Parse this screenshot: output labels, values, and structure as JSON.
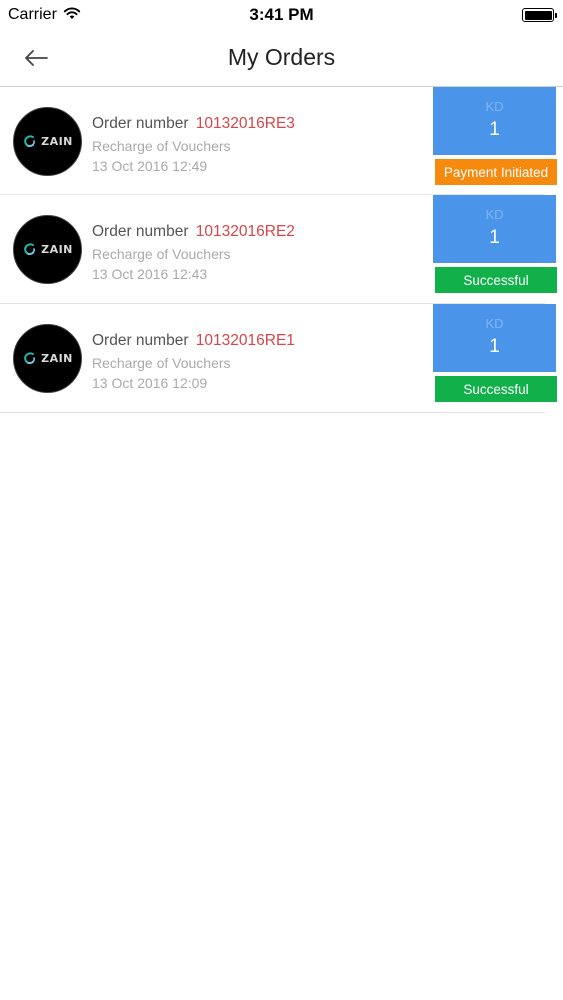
{
  "status_bar": {
    "carrier": "Carrier",
    "time": "3:41 PM",
    "icons": [
      "wifi-icon",
      "battery-icon"
    ]
  },
  "nav": {
    "title": "My Orders",
    "back_icon": "arrow-left-icon"
  },
  "orders": [
    {
      "label": "Order number",
      "number": "10132016RE3",
      "description": "Recharge of Vouchers",
      "date": "13 Oct 2016 12:49",
      "currency": "KD",
      "amount": "1",
      "status": "Payment Initiated",
      "status_color": "#f58a0f",
      "logo_text": "ZAIN"
    },
    {
      "label": "Order number",
      "number": "10132016RE2",
      "description": "Recharge of Vouchers",
      "date": "13 Oct 2016 12:43",
      "currency": "KD",
      "amount": "1",
      "status": "Successful",
      "status_color": "#12b04a",
      "logo_text": "ZAIN"
    },
    {
      "label": "Order number",
      "number": "10132016RE1",
      "description": "Recharge of Vouchers",
      "date": "13 Oct 2016 12:09",
      "currency": "KD",
      "amount": "1",
      "status": "Successful",
      "status_color": "#12b04a",
      "logo_text": "ZAIN"
    }
  ],
  "colors": {
    "accent_blue": "#4a94ea",
    "order_number_red": "#d9454a",
    "pending_orange": "#f58a0f",
    "success_green": "#12b04a"
  }
}
